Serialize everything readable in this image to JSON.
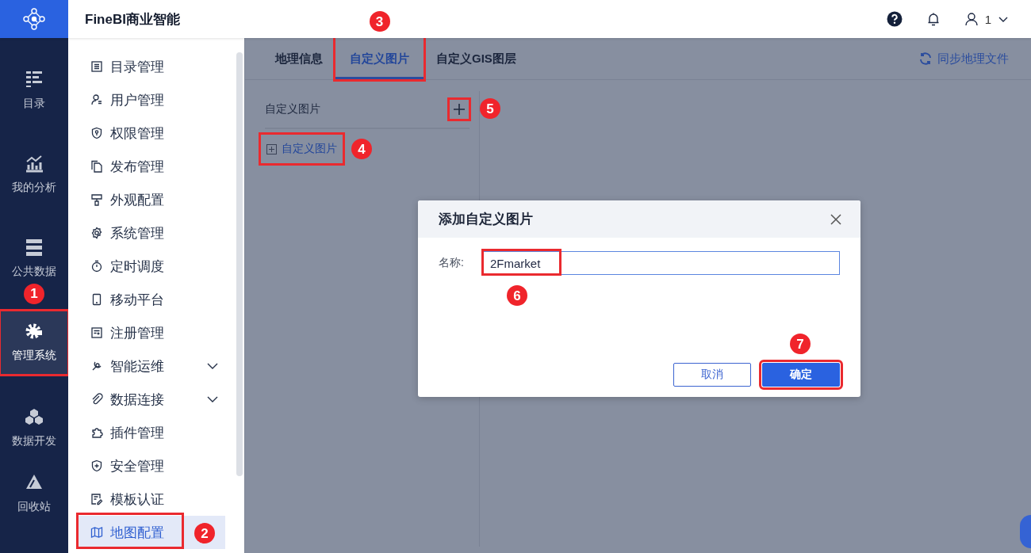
{
  "app": {
    "title": "FineBI商业智能",
    "user_name": "1"
  },
  "nav": [
    {
      "label": "目录",
      "selected": false,
      "highlighted": false
    },
    {
      "label": "我的分析",
      "selected": false,
      "highlighted": false
    },
    {
      "label": "公共数据",
      "selected": false,
      "highlighted": false
    },
    {
      "label": "管理系统",
      "selected": true,
      "highlighted": true,
      "callout": "1"
    },
    {
      "label": "数据开发",
      "selected": false,
      "highlighted": false
    },
    {
      "label": "回收站",
      "selected": false,
      "highlighted": false
    }
  ],
  "menu": [
    {
      "label": "目录管理",
      "expandable": false,
      "selected": false,
      "highlighted": false
    },
    {
      "label": "用户管理",
      "expandable": false,
      "selected": false,
      "highlighted": false
    },
    {
      "label": "权限管理",
      "expandable": false,
      "selected": false,
      "highlighted": false
    },
    {
      "label": "发布管理",
      "expandable": false,
      "selected": false,
      "highlighted": false
    },
    {
      "label": "外观配置",
      "expandable": false,
      "selected": false,
      "highlighted": false
    },
    {
      "label": "系统管理",
      "expandable": false,
      "selected": false,
      "highlighted": false
    },
    {
      "label": "定时调度",
      "expandable": false,
      "selected": false,
      "highlighted": false
    },
    {
      "label": "移动平台",
      "expandable": false,
      "selected": false,
      "highlighted": false
    },
    {
      "label": "注册管理",
      "expandable": false,
      "selected": false,
      "highlighted": false
    },
    {
      "label": "智能运维",
      "expandable": true,
      "selected": false,
      "highlighted": false
    },
    {
      "label": "数据连接",
      "expandable": true,
      "selected": false,
      "highlighted": false
    },
    {
      "label": "插件管理",
      "expandable": false,
      "selected": false,
      "highlighted": false
    },
    {
      "label": "安全管理",
      "expandable": false,
      "selected": false,
      "highlighted": false
    },
    {
      "label": "模板认证",
      "expandable": false,
      "selected": false,
      "highlighted": false
    },
    {
      "label": "地图配置",
      "expandable": false,
      "selected": true,
      "highlighted": true,
      "callout": "2"
    }
  ],
  "tabs": [
    {
      "label": "地理信息",
      "selected": false,
      "highlighted": false
    },
    {
      "label": "自定义图片",
      "selected": true,
      "highlighted": true,
      "callout": "3"
    },
    {
      "label": "自定义GIS图层",
      "selected": false,
      "highlighted": false
    }
  ],
  "sync_button": "同步地理文件",
  "panel": {
    "title": "自定义图片",
    "add_highlighted": true,
    "add_callout": "5",
    "tree": [
      {
        "label": "自定义图片",
        "expanded": false,
        "highlighted": true,
        "callout": "4"
      }
    ]
  },
  "dialog": {
    "title": "添加自定义图片",
    "field_label": "名称:",
    "field_value": "2Fmarket",
    "value_highlighted": true,
    "value_callout": "6",
    "buttons": [
      {
        "label": "取消",
        "kind": "secondary",
        "highlighted": false
      },
      {
        "label": "确定",
        "kind": "primary",
        "highlighted": true,
        "callout": "7"
      }
    ]
  }
}
